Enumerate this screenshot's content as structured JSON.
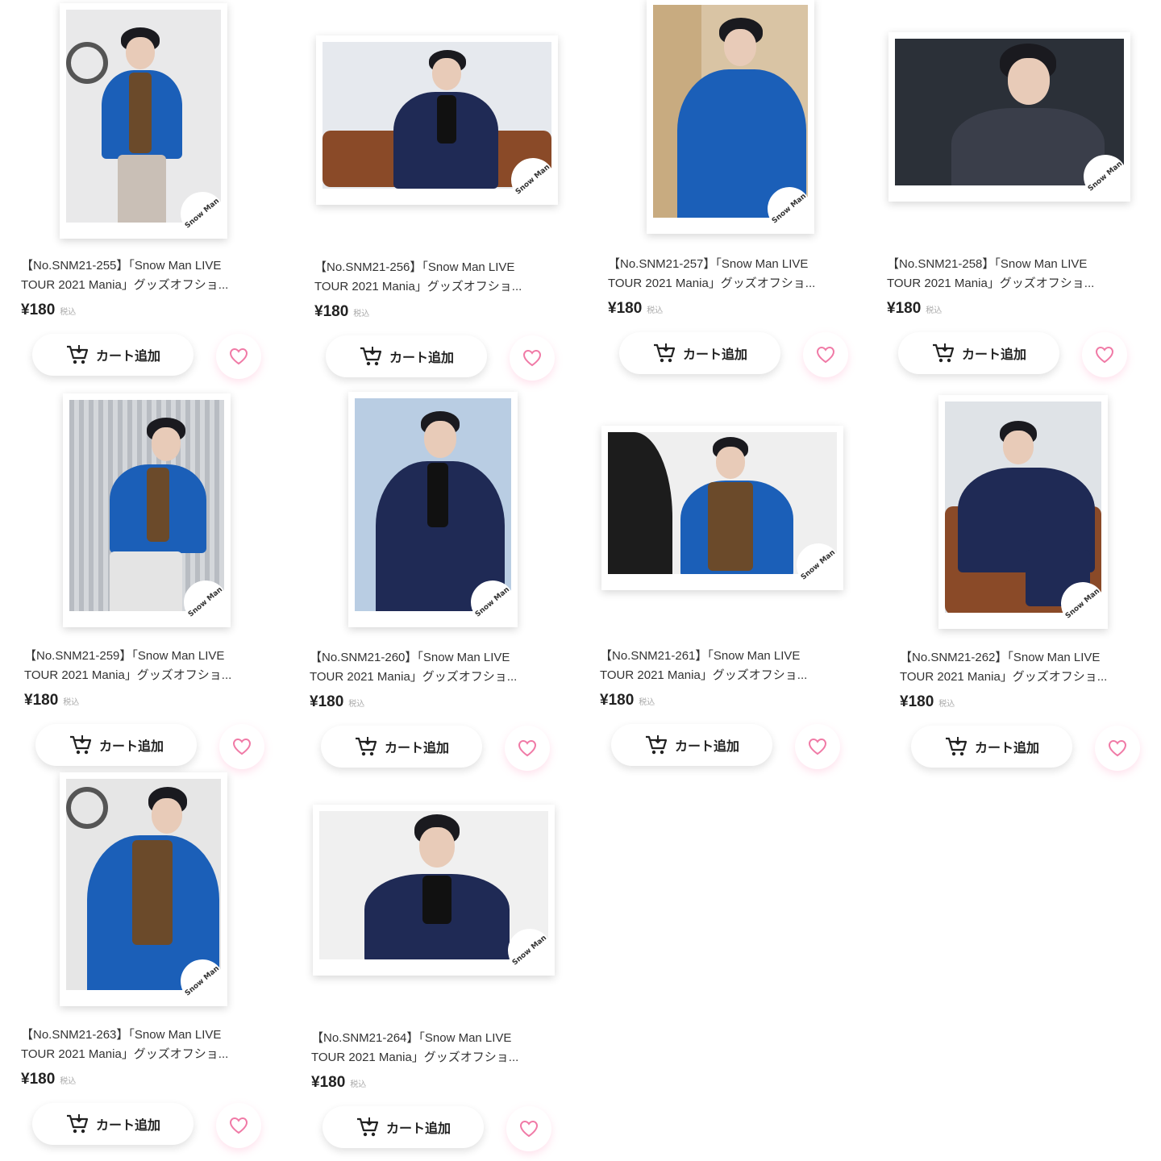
{
  "brand_stamp": "Snow Man",
  "products": [
    {
      "title_line1": "【No.SNM21-255】「Snow Man LIVE",
      "title_line2": "TOUR 2021 Mania」グッズオフショ...",
      "price": "¥180",
      "tax_label": "税込",
      "cart_label": "カート追加"
    },
    {
      "title_line1": "【No.SNM21-256】「Snow Man LIVE",
      "title_line2": "TOUR 2021 Mania」グッズオフショ...",
      "price": "¥180",
      "tax_label": "税込",
      "cart_label": "カート追加"
    },
    {
      "title_line1": "【No.SNM21-257】「Snow Man LIVE",
      "title_line2": "TOUR 2021 Mania」グッズオフショ...",
      "price": "¥180",
      "tax_label": "税込",
      "cart_label": "カート追加"
    },
    {
      "title_line1": "【No.SNM21-258】「Snow Man LIVE",
      "title_line2": "TOUR 2021 Mania」グッズオフショ...",
      "price": "¥180",
      "tax_label": "税込",
      "cart_label": "カート追加"
    },
    {
      "title_line1": "【No.SNM21-259】「Snow Man LIVE",
      "title_line2": "TOUR 2021 Mania」グッズオフショ...",
      "price": "¥180",
      "tax_label": "税込",
      "cart_label": "カート追加"
    },
    {
      "title_line1": "【No.SNM21-260】「Snow Man LIVE",
      "title_line2": "TOUR 2021 Mania」グッズオフショ...",
      "price": "¥180",
      "tax_label": "税込",
      "cart_label": "カート追加"
    },
    {
      "title_line1": "【No.SNM21-261】「Snow Man LIVE",
      "title_line2": "TOUR 2021 Mania」グッズオフショ...",
      "price": "¥180",
      "tax_label": "税込",
      "cart_label": "カート追加"
    },
    {
      "title_line1": "【No.SNM21-262】「Snow Man LIVE",
      "title_line2": "TOUR 2021 Mania」グッズオフショ...",
      "price": "¥180",
      "tax_label": "税込",
      "cart_label": "カート追加"
    },
    {
      "title_line1": "【No.SNM21-263】「Snow Man LIVE",
      "title_line2": "TOUR 2021 Mania」グッズオフショ...",
      "price": "¥180",
      "tax_label": "税込",
      "cart_label": "カート追加"
    },
    {
      "title_line1": "【No.SNM21-264】「Snow Man LIVE",
      "title_line2": "TOUR 2021 Mania」グッズオフショ...",
      "price": "¥180",
      "tax_label": "税込",
      "cart_label": "カート追加"
    }
  ],
  "icons": {
    "cart": "cart-icon",
    "favorite": "heart-icon"
  },
  "colors": {
    "heart": "#f07aa6",
    "blue_jacket": "#1b5fb8",
    "navy_suit": "#1f2a55",
    "brown_shirt": "#6b4a2a"
  }
}
